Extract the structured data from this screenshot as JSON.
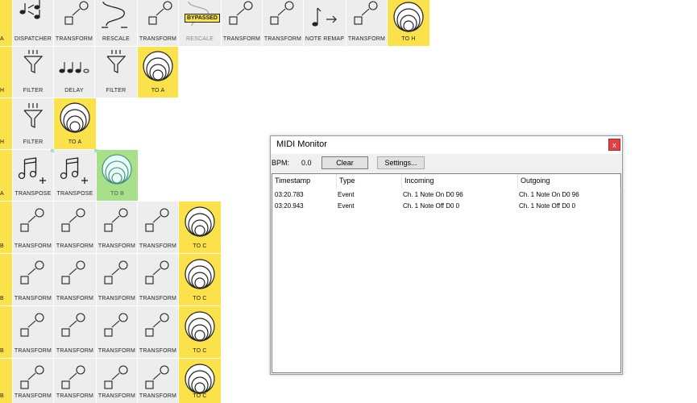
{
  "tiles": {
    "row0": [
      {
        "label": "DISPATCHER",
        "icon": "dispatcher-icon"
      },
      {
        "label": "TRANSFORM",
        "icon": "transform-icon"
      },
      {
        "label": "RESCALE",
        "icon": "rescale-icon"
      },
      {
        "label": "TRANSFORM",
        "icon": "transform-icon"
      },
      {
        "label": "RESCALE",
        "icon": "rescale-icon",
        "badge": "BYPASSED"
      },
      {
        "label": "TRANSFORM",
        "icon": "transform-icon"
      },
      {
        "label": "TRANSFORM",
        "icon": "transform-icon"
      },
      {
        "label": "NOTE REMAP",
        "icon": "note-remap-icon"
      },
      {
        "label": "TRANSFORM",
        "icon": "transform-icon"
      },
      {
        "label": "TO H",
        "icon": "output-rings-icon"
      }
    ],
    "row1": [
      {
        "label": "FILTER",
        "icon": "filter-icon"
      },
      {
        "label": "DELAY",
        "icon": "delay-icon"
      },
      {
        "label": "FILTER",
        "icon": "filter-icon"
      },
      {
        "label": "TO A",
        "icon": "output-rings-icon"
      }
    ],
    "row2": [
      {
        "label": "FILTER",
        "icon": "filter-icon"
      },
      {
        "label": "TO A",
        "icon": "output-rings-icon"
      }
    ],
    "row3": [
      {
        "label": "TRANSPOSE",
        "icon": "transpose-icon"
      },
      {
        "label": "TRANSPOSE",
        "icon": "transpose-icon"
      },
      {
        "label": "TO B",
        "icon": "output-rings-icon"
      }
    ],
    "row4": [
      {
        "label": "TRANSFORM"
      },
      {
        "label": "TRANSFORM"
      },
      {
        "label": "TRANSFORM"
      },
      {
        "label": "TRANSFORM"
      },
      {
        "label": "TO C"
      }
    ],
    "row5": [
      {
        "label": "TRANSFORM"
      },
      {
        "label": "TRANSFORM"
      },
      {
        "label": "TRANSFORM"
      },
      {
        "label": "TRANSFORM"
      },
      {
        "label": "TO C"
      }
    ],
    "row6": [
      {
        "label": "TRANSFORM"
      },
      {
        "label": "TRANSFORM"
      },
      {
        "label": "TRANSFORM"
      },
      {
        "label": "TRANSFORM"
      },
      {
        "label": "TO C"
      }
    ],
    "row7": [
      {
        "label": "TRANSFORM"
      },
      {
        "label": "TRANSFORM"
      },
      {
        "label": "TRANSFORM"
      },
      {
        "label": "TRANSFORM"
      },
      {
        "label": "TO C"
      }
    ]
  },
  "edge_labels": [
    "A",
    "H",
    "H",
    "A",
    "B",
    "B",
    "B",
    "B"
  ],
  "colors": {
    "tile": "#ededed",
    "output": "#fbe24a",
    "selected": "#a8e08a",
    "close": "#e04343"
  },
  "midi_monitor": {
    "title": "MIDI Monitor",
    "close_label": "x",
    "bpm_label": "BPM:",
    "bpm_value": "0.0",
    "clear_label": "Clear",
    "settings_label": "Settings...",
    "columns": [
      "Timestamp",
      "Type",
      "Incoming",
      "Outgoing"
    ],
    "rows": [
      {
        "timestamp": "03:20.783",
        "type": "Event",
        "incoming": "Ch. 1 Note On D0 96",
        "outgoing": "Ch. 1 Note On D0 96"
      },
      {
        "timestamp": "03:20.943",
        "type": "Event",
        "incoming": "Ch. 1 Note Off D0 0",
        "outgoing": "Ch. 1 Note Off D0 0"
      }
    ]
  }
}
